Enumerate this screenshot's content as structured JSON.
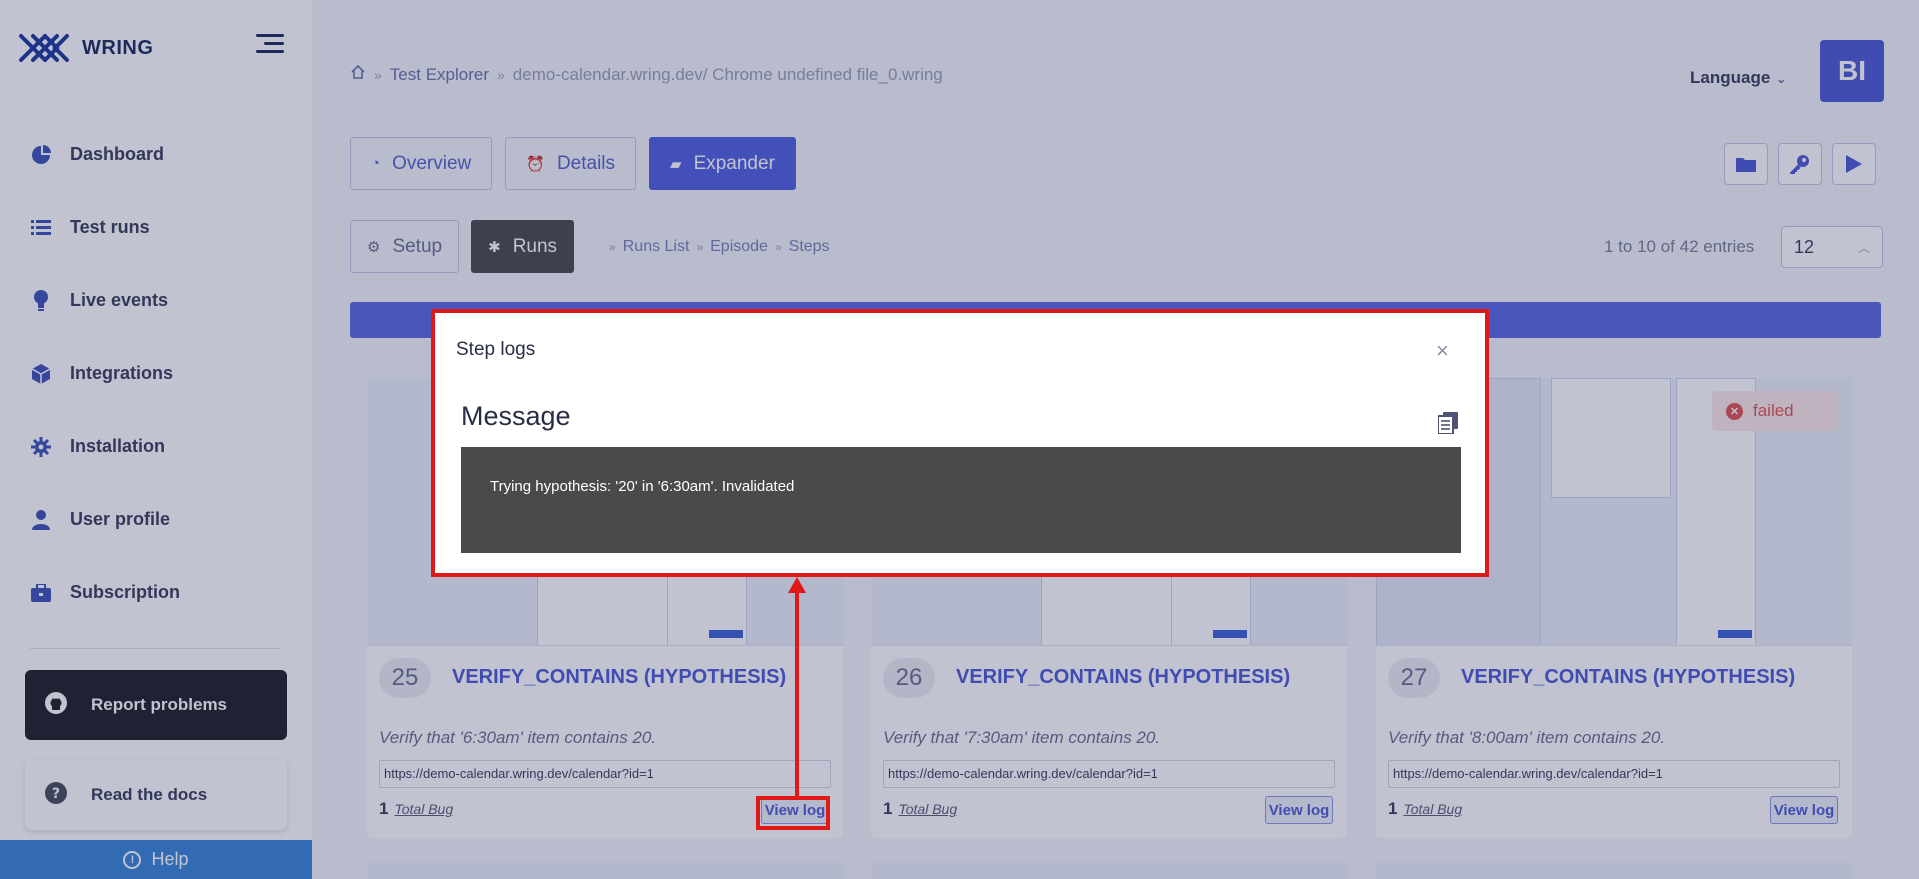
{
  "brand": {
    "name": "WRING"
  },
  "sidebar": {
    "items": [
      {
        "label": "Dashboard",
        "icon": "pie-chart-icon"
      },
      {
        "label": "Test runs",
        "icon": "list-icon"
      },
      {
        "label": "Live events",
        "icon": "lightbulb-icon"
      },
      {
        "label": "Integrations",
        "icon": "cube-icon"
      },
      {
        "label": "Installation",
        "icon": "gear-icon"
      },
      {
        "label": "User profile",
        "icon": "user-icon"
      },
      {
        "label": "Subscription",
        "icon": "briefcase-icon"
      }
    ],
    "report_label": "Report problems",
    "docs_label": "Read the docs",
    "help_label": "Help"
  },
  "header": {
    "breadcrumb": [
      {
        "label": "Test Explorer"
      },
      {
        "label": "demo-calendar.wring.dev/ Chrome undefined file_0.wring"
      }
    ],
    "language_label": "Language",
    "avatar_initials": "BI"
  },
  "tabs": [
    {
      "label": "Overview"
    },
    {
      "label": "Details"
    },
    {
      "label": "Expander"
    }
  ],
  "subtabs": [
    {
      "label": "Setup"
    },
    {
      "label": "Runs"
    }
  ],
  "runcrumbs": [
    "Runs List",
    "Episode",
    "Steps"
  ],
  "pagination": {
    "entries_text": "1 to 10 of 42 entries",
    "page_size": "12"
  },
  "cards": [
    {
      "number": "25",
      "title": "VERIFY_CONTAINS (HYPOTHESIS)",
      "description": "Verify that '6:30am' item contains 20.",
      "url": "https://demo-calendar.wring.dev/calendar?id=1",
      "bug_count": "1",
      "bug_label": "Total Bug",
      "view_log_label": "View log"
    },
    {
      "number": "26",
      "title": "VERIFY_CONTAINS (HYPOTHESIS)",
      "description": "Verify that '7:30am' item contains 20.",
      "url": "https://demo-calendar.wring.dev/calendar?id=1",
      "bug_count": "1",
      "bug_label": "Total Bug",
      "view_log_label": "View log"
    },
    {
      "number": "27",
      "title": "VERIFY_CONTAINS (HYPOTHESIS)",
      "description": "Verify that '8:00am' item contains 20.",
      "url": "https://demo-calendar.wring.dev/calendar?id=1",
      "bug_count": "1",
      "bug_label": "Total Bug",
      "view_log_label": "View log"
    }
  ],
  "status_badge": {
    "label": "failed",
    "color": "#e25353"
  },
  "modal": {
    "title": "Step logs",
    "close": "×",
    "section_title": "Message",
    "message": "Trying hypothesis: '20' in '6:30am'. Invalidated"
  },
  "colors": {
    "accent": "#5260e0",
    "highlight": "#e01818",
    "help_bar": "#3a86d8"
  }
}
